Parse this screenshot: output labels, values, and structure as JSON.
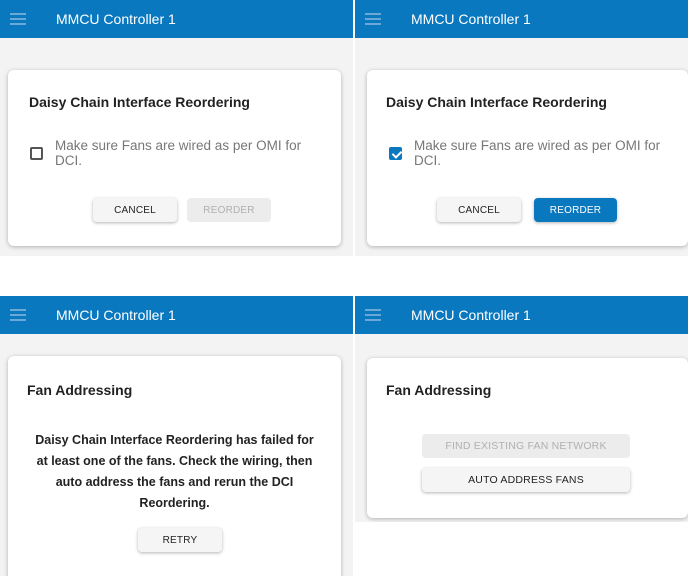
{
  "colors": {
    "appbar": "#0a78bf",
    "primary_button": "#0a78bf"
  },
  "icons": {
    "menu": "hamburger-menu-icon",
    "checkbox_checked": "check-icon"
  },
  "panels": [
    {
      "app_title": "MMCU Controller 1",
      "card_title": "Daisy Chain Interface Reordering",
      "checkbox_label": "Make sure Fans are wired as per OMI for DCI.",
      "checked": false,
      "cancel_label": "CANCEL",
      "reorder_label": "REORDER"
    },
    {
      "app_title": "MMCU Controller 1",
      "card_title": "Daisy Chain Interface Reordering",
      "checkbox_label": "Make sure Fans are wired as per OMI for DCI.",
      "checked": true,
      "cancel_label": "CANCEL",
      "reorder_label": "REORDER"
    },
    {
      "app_title": "MMCU Controller 1",
      "card_title": "Fan Addressing",
      "message": "Daisy Chain Interface Reordering has failed for at least one of the fans. Check the wiring, then auto address the fans and rerun the DCI Reordering.",
      "retry_label": "RETRY"
    },
    {
      "app_title": "MMCU Controller 1",
      "card_title": "Fan Addressing",
      "find_label": "FIND EXISTING FAN NETWORK",
      "auto_label": "AUTO ADDRESS FANS"
    }
  ]
}
